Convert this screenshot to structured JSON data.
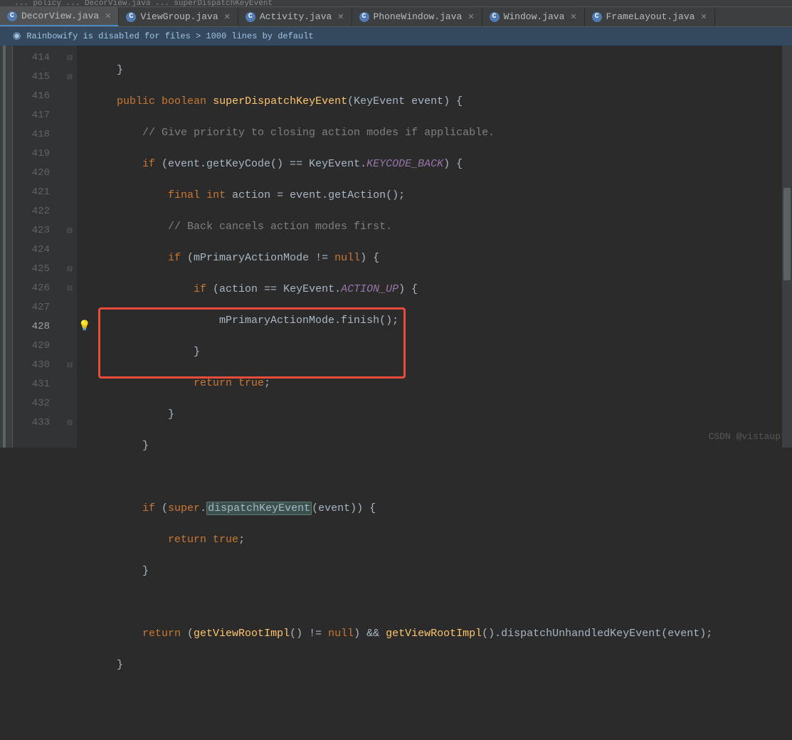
{
  "breadcrumb": "... policy ... DecorView.java ... superDispatchKeyEvent",
  "tabs": [
    {
      "label": "DecorView.java",
      "active": true
    },
    {
      "label": "ViewGroup.java",
      "active": false
    },
    {
      "label": "Activity.java",
      "active": false
    },
    {
      "label": "PhoneWindow.java",
      "active": false
    },
    {
      "label": "Window.java",
      "active": false
    },
    {
      "label": "FrameLayout.java",
      "active": false
    }
  ],
  "banner": "Rainbowify is disabled for files > 1000 lines by default",
  "lines": {
    "414": "414",
    "415": "415",
    "416": "416",
    "417": "417",
    "418": "418",
    "419": "419",
    "420": "420",
    "421": "421",
    "422": "422",
    "423": "423",
    "424": "424",
    "425": "425",
    "426": "426",
    "427": "427",
    "428": "428",
    "429": "429",
    "430": "430",
    "431": "431",
    "432": "432",
    "433": "433"
  },
  "code": {
    "l414_brace": "    }",
    "l415_indent": "    ",
    "l415_public": "public",
    "l415_boolean": "boolean",
    "l415_method": "superDispatchKeyEvent",
    "l415_params": "(KeyEvent event) {",
    "l416": "        // Give priority to closing action modes if applicable.",
    "l417_pre": "        ",
    "l417_if": "if",
    "l417_cond": " (event.getKeyCode() == KeyEvent.",
    "l417_const": "KEYCODE_BACK",
    "l417_end": ") {",
    "l418_pre": "            ",
    "l418_final": "final",
    "l418_int": "int",
    "l418_rest": " action = event.getAction();",
    "l419": "            // Back cancels action modes first.",
    "l420_pre": "            ",
    "l420_if": "if",
    "l420_cond": " (mPrimaryActionMode != ",
    "l420_null": "null",
    "l420_end": ") {",
    "l421_pre": "                ",
    "l421_if": "if",
    "l421_cond": " (action == KeyEvent.",
    "l421_const": "ACTION_UP",
    "l421_end": ") {",
    "l422": "                    mPrimaryActionMode.finish();",
    "l423": "                }",
    "l424_pre": "                ",
    "l424_return": "return",
    "l424_true": " true",
    "l424_semi": ";",
    "l425": "            }",
    "l426": "        }",
    "l428_pre": "        ",
    "l428_if": "if",
    "l428_op": " (",
    "l428_super": "super",
    "l428_dot": ".",
    "l428_disp": "dispatchKeyEvent",
    "l428_ev": "(event)) {",
    "l429_pre": "            ",
    "l429_return": "return",
    "l429_true": " true",
    "l429_semi": ";",
    "l430": "        }",
    "l432_pre": "        ",
    "l432_return": "return",
    "l432_op1": " (",
    "l432_fn1": "getViewRootImpl",
    "l432_mid": "() != ",
    "l432_null": "null",
    "l432_and": ") && ",
    "l432_fn2": "getViewRootImpl",
    "l432_tail": "().dispatchUnhandledKeyEvent(event);",
    "l433": "    }"
  },
  "watermark": "CSDN @vistaup"
}
